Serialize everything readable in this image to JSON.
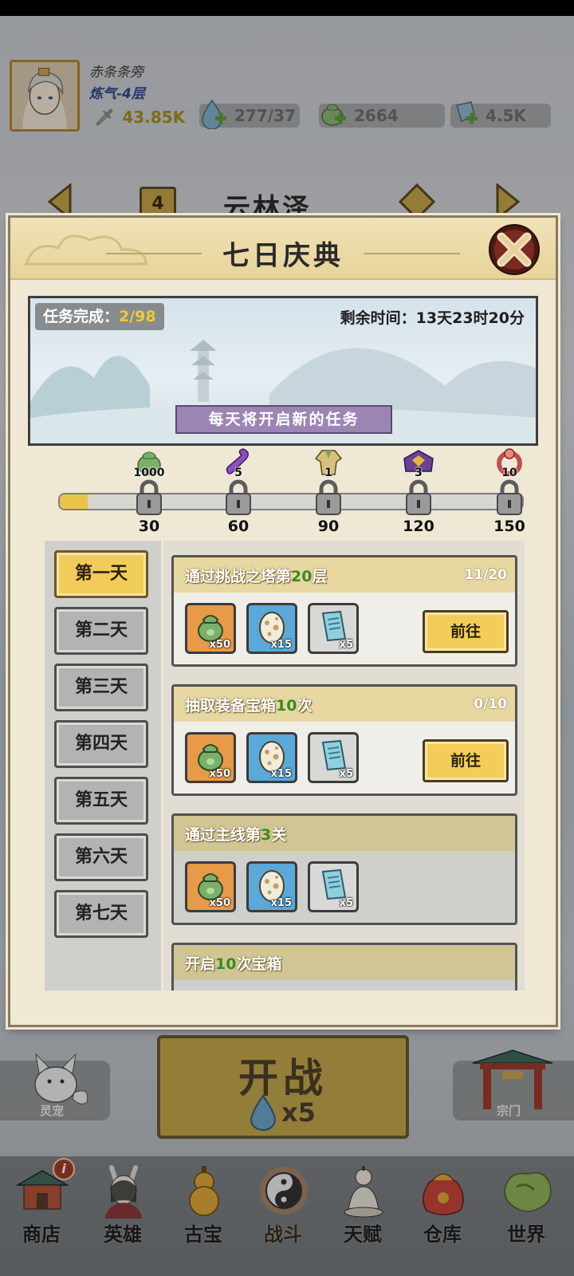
{
  "player": {
    "name": "赤条条旁",
    "realm": "炼气-4层",
    "power": "43.85K"
  },
  "resources": {
    "stamina": "277/37",
    "jade": "2664",
    "crystal": "4.5K"
  },
  "stage": {
    "number": "4",
    "name": "云林泽"
  },
  "modal": {
    "title": "七日庆典",
    "task_done_label": "任务完成：",
    "task_done_value": "2/98",
    "remaining_time": "剩余时间：13天23时20分",
    "note": "每天将开启新的任务",
    "progress_fraction": 0.06
  },
  "milestones": [
    {
      "label": "30",
      "reward_count": "1000",
      "reward_icon": "jade-pouch-icon"
    },
    {
      "label": "60",
      "reward_count": "5",
      "reward_icon": "purple-ribbon-icon"
    },
    {
      "label": "90",
      "reward_count": "1",
      "reward_icon": "armor-robe-icon"
    },
    {
      "label": "120",
      "reward_count": "3",
      "reward_icon": "purple-chest-icon"
    },
    {
      "label": "150",
      "reward_count": "10",
      "reward_icon": "red-ring-icon"
    }
  ],
  "days": [
    "第一天",
    "第二天",
    "第三天",
    "第四天",
    "第五天",
    "第六天",
    "第七天"
  ],
  "tasks": [
    {
      "title_pre": "通过挑战之塔第",
      "title_num": "20",
      "title_post": "层",
      "progress": "11/20",
      "rewards": [
        "x50",
        "x15",
        "x5"
      ],
      "button": "前往"
    },
    {
      "title_pre": "抽取装备宝箱",
      "title_num": "10",
      "title_post": "次",
      "progress": "0/10",
      "rewards": [
        "x50",
        "x15",
        "x5"
      ],
      "button": "前往"
    },
    {
      "title_pre": "通过主线第",
      "title_num": "3",
      "title_post": "关",
      "progress": "",
      "rewards": [
        "x50",
        "x15",
        "x5"
      ],
      "button": ""
    },
    {
      "title_pre": "开启",
      "title_num": "10",
      "title_post": "次宝箱",
      "progress": "",
      "rewards": [],
      "button": ""
    }
  ],
  "side_buttons": {
    "pet": "灵宠",
    "sect": "宗门"
  },
  "fight": {
    "label": "开战",
    "cost": "x5"
  },
  "nav": [
    "商店",
    "英雄",
    "古宝",
    "战斗",
    "天赋",
    "仓库",
    "世界"
  ],
  "colors": {
    "accent_gold": "#f1cc58",
    "highlight_green": "#3a8a22",
    "note_purple": "#9c84b4",
    "task_done_yellow": "#f0c935"
  }
}
